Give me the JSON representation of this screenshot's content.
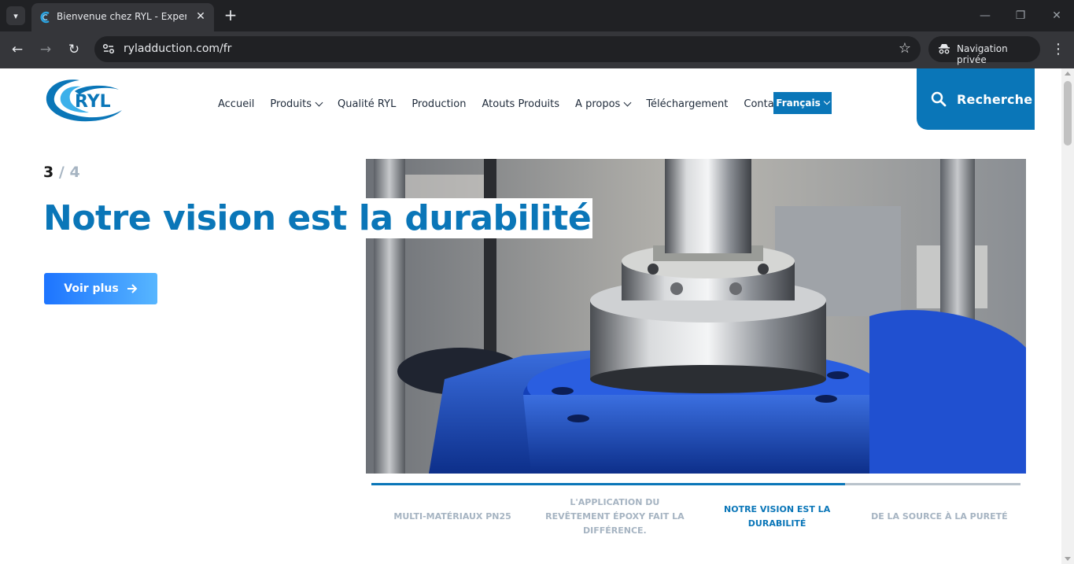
{
  "browser": {
    "tab_title": "Bienvenue chez RYL - Expertise",
    "url": "ryladduction.com/fr",
    "private_label": "Navigation privée"
  },
  "site": {
    "logo_text": "RYL",
    "brand_color": "#0a76b8",
    "nav": {
      "items": [
        {
          "label": "Accueil",
          "has_dropdown": false
        },
        {
          "label": "Produits",
          "has_dropdown": true
        },
        {
          "label": "Qualité RYL",
          "has_dropdown": false
        },
        {
          "label": "Production",
          "has_dropdown": false
        },
        {
          "label": "Atouts Produits",
          "has_dropdown": false
        },
        {
          "label": "A propos",
          "has_dropdown": true
        },
        {
          "label": "Téléchargement",
          "has_dropdown": false
        },
        {
          "label": "Contact",
          "has_dropdown": false
        }
      ],
      "language": "Français"
    },
    "search_label": "Recherche"
  },
  "slider": {
    "current": "3",
    "separator": "/",
    "total": "4",
    "headline": "Notre vision est la durabilité",
    "cta_label": "Voir plus",
    "progress": 0.73,
    "tabs": [
      "MULTI-MATÉRIAUX PN25",
      "L'APPLICATION DU REVÊTEMENT ÉPOXY FAIT LA DIFFÉRENCE.",
      "NOTRE VISION EST LA DURABILITÉ",
      "DE LA SOURCE À LA PURETÉ"
    ],
    "active_tab": 2
  }
}
